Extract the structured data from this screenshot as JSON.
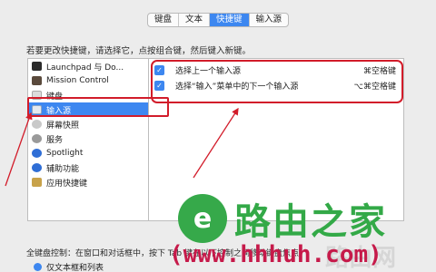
{
  "tabs": [
    {
      "label": "键盘",
      "active": false
    },
    {
      "label": "文本",
      "active": false
    },
    {
      "label": "快捷键",
      "active": true
    },
    {
      "label": "输入源",
      "active": false
    }
  ],
  "instruction": "若要更改快捷键，请选择它，点按组合键，然后键入新键。",
  "categories": [
    {
      "label": "Launchpad 与 Do...",
      "icon": "launchpad-icon"
    },
    {
      "label": "Mission Control",
      "icon": "mission-control-icon"
    },
    {
      "label": "键盘",
      "icon": "keyboard-icon"
    },
    {
      "label": "输入源",
      "icon": "input-source-icon",
      "selected": true
    },
    {
      "label": "屏幕快照",
      "icon": "screenshot-icon"
    },
    {
      "label": "服务",
      "icon": "services-gear-icon"
    },
    {
      "label": "Spotlight",
      "icon": "spotlight-icon"
    },
    {
      "label": "辅助功能",
      "icon": "accessibility-icon"
    },
    {
      "label": "应用快捷键",
      "icon": "app-shortcuts-icon"
    }
  ],
  "shortcuts": [
    {
      "label": "选择上一个输入源",
      "shortcut": "⌘空格键",
      "checked": true
    },
    {
      "label": "选择“输入”菜单中的下一个输入源",
      "shortcut": "⌥⌘空格键",
      "checked": true
    }
  ],
  "footer": {
    "text": "全键盘控制：在窗口和对话框中，按下 Tab 键在以下控制之间移动键盘焦点：",
    "radio_label": "仅文本框和列表"
  },
  "watermark": {
    "logo_letter": "e",
    "text": "路由之家",
    "url": "(www.hhhuh.com)",
    "ghost": "路由网"
  },
  "colors": {
    "accent": "#3d87f0",
    "annotation_red": "#d21c2a",
    "watermark_green": "#33a947"
  }
}
